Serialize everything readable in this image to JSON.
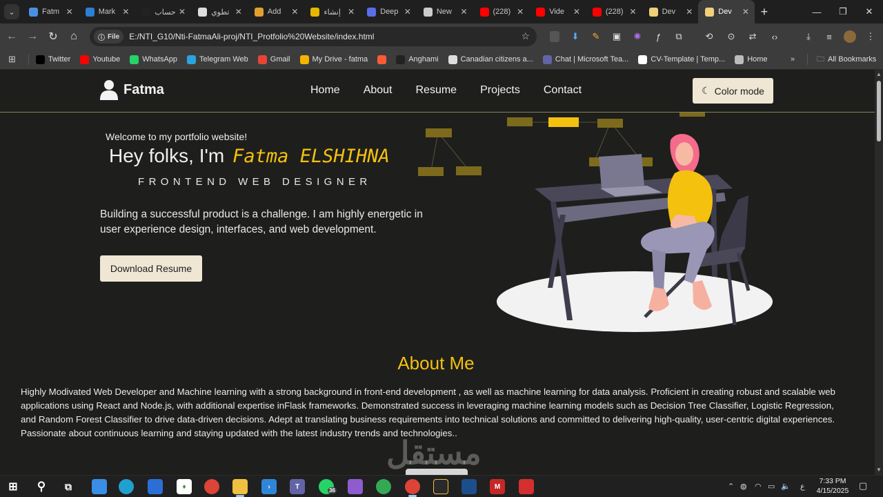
{
  "browser": {
    "tabs": [
      {
        "label": "Fatm",
        "color": "#4a90e2"
      },
      {
        "label": "Mark",
        "color": "#2d7fd3"
      },
      {
        "label": "حساب",
        "color": "#222222"
      },
      {
        "label": "تطوي",
        "color": "#dddddd"
      },
      {
        "label": "Add",
        "color": "#e0a030"
      },
      {
        "label": "إنشاء",
        "color": "#e6b800"
      },
      {
        "label": "Deep",
        "color": "#5a6ee8"
      },
      {
        "label": "New",
        "color": "#cccccc"
      },
      {
        "label": "(228)",
        "color": "#ff0000"
      },
      {
        "label": "Vide",
        "color": "#ff0000"
      },
      {
        "label": "(228)",
        "color": "#ff0000"
      },
      {
        "label": "Dev",
        "color": "#f0d078"
      },
      {
        "label": "Dev",
        "color": "#f0d078",
        "active": true
      }
    ],
    "address": {
      "chip": "File",
      "url": "E:/NTI_G10/Nti-FatmaAli-proj/NTI_Protfolio%20Website/index.html"
    },
    "bookmarks": [
      {
        "label": "Twitter",
        "color": "#000000"
      },
      {
        "label": "Youtube",
        "color": "#ff0000"
      },
      {
        "label": "WhatsApp",
        "color": "#25d366"
      },
      {
        "label": "Telegram Web",
        "color": "#2aa3e0"
      },
      {
        "label": "Gmail",
        "color": "#ea4335"
      },
      {
        "label": "My Drive - fatma",
        "color": "#f4b400"
      },
      {
        "label": "",
        "color": "#ff5a36"
      },
      {
        "label": "Anghami",
        "color": "#222222"
      },
      {
        "label": "Canadian citizens a...",
        "color": "#dddddd"
      },
      {
        "label": "Chat | Microsoft Tea...",
        "color": "#6264a7"
      },
      {
        "label": "CV-Template | Temp...",
        "color": "#ffffff"
      },
      {
        "label": "Home",
        "color": "#bbbbbb"
      }
    ],
    "all_bookmarks": "All Bookmarks"
  },
  "site": {
    "brand": "Fatma",
    "nav": [
      "Home",
      "About",
      "Resume",
      "Projects",
      "Contact"
    ],
    "color_mode": "Color mode",
    "hero": {
      "welcome": "Welcome to my portfolio website!",
      "greeting": "Hey folks, I'm",
      "name": "Fatma ELSHIHNA",
      "role": "FRONTEND WEB DESIGNER",
      "tagline": "Building a successful product is a challenge. I am highly energetic in user experience design, interfaces, and web development.",
      "download": "Download Resume"
    },
    "about": {
      "title": "About Me",
      "text": "Highly Modivated Web Developer and Machine learning with a strong background in front-end development , as well as machine learning for data analysis. Proficient in creating robust and scalable web applications using React and Node.js, with additional expertise inFlask frameworks. Demonstrated success in leveraging machine learning models such as Decision Tree Classifier, Logistic Regression, and Random Forest Classifier to drive data-driven decisions. Adept at translating business requirements into technical solutions and committed to delivering high-quality, user-centric digital experiences. Passionate about continuous learning and staying updated with the latest industry trends and technologies.."
    },
    "watermark": "مستقل",
    "accent": "#f4c10f"
  },
  "taskbar": {
    "whatsapp_badge": "36",
    "lang": "ع",
    "time": "7:33 PM",
    "date": "4/15/2025"
  }
}
